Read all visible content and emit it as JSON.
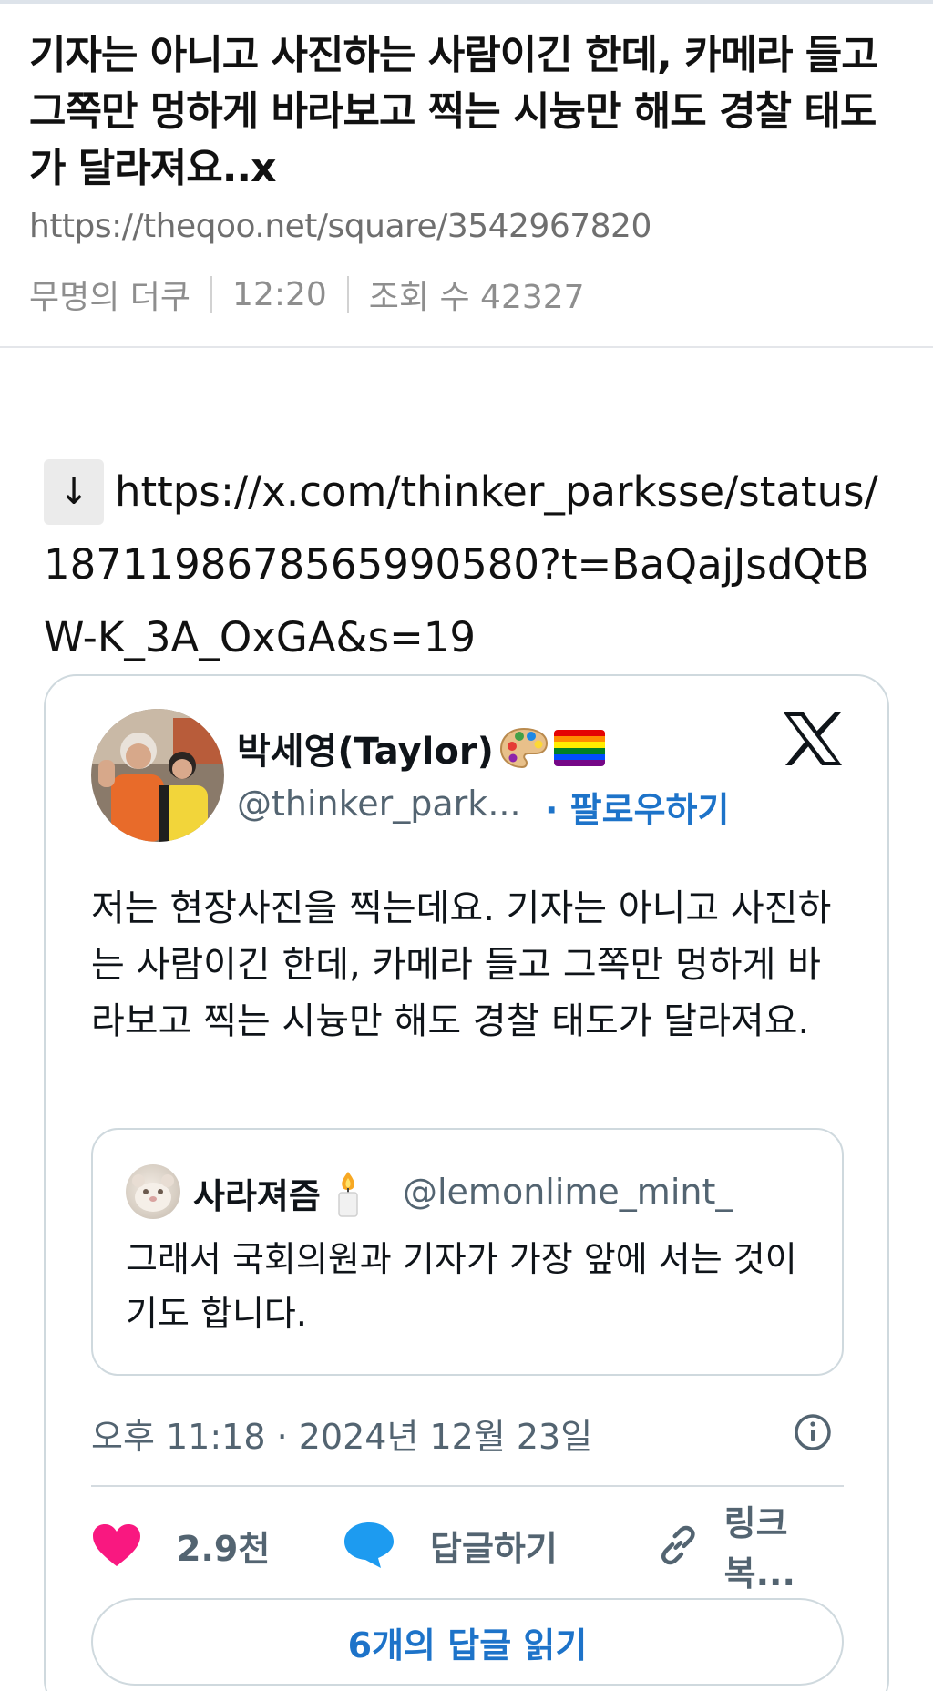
{
  "post": {
    "title": "기자는 아니고 사진하는 사람이긴 한데, 카메라 들고 그쪽만 멍하게 바라보고 찍는 시늉만 해도 경찰 태도가 달라져요..x",
    "url": "https://theqoo.net/square/3542967820",
    "author": "무명의 더쿠",
    "time": "12:20",
    "views": "조회 수 42327"
  },
  "link": {
    "arrow": "↓",
    "url": "https://x.com/thinker_parksse/status/1871198678565990580?t=BaQajJsdQtBW-K_3A_OxGA&s=19"
  },
  "tweet": {
    "author_name": "박세영(Taylor)",
    "author_handle": "@thinker_park...",
    "follow_label": "· 팔로우하기",
    "text": "저는 현장사진을 찍는데요. 기자는 아니고 사진하는 사람이긴 한데, 카메라 들고 그쪽만 멍하게 바라보고 찍는 시늉만 해도 경찰 태도가 달라져요.",
    "quote": {
      "author_name": "사라져즘",
      "author_handle": "@lemonlime_mint_",
      "text": "그래서 국회의원과 기자가 가장 앞에 서는 것이기도 합니다."
    },
    "timestamp": "오후 11:18 · 2024년 12월 23일",
    "likes": "2.9천",
    "reply_label": "답글하기",
    "copy_link_label": "링크 복...",
    "read_replies_label": "6개의 답글 읽기"
  },
  "colors": {
    "accent_blue": "#1d73c9",
    "like_pink": "#f91880",
    "reply_blue": "#1d9bf0",
    "muted": "#536471"
  }
}
